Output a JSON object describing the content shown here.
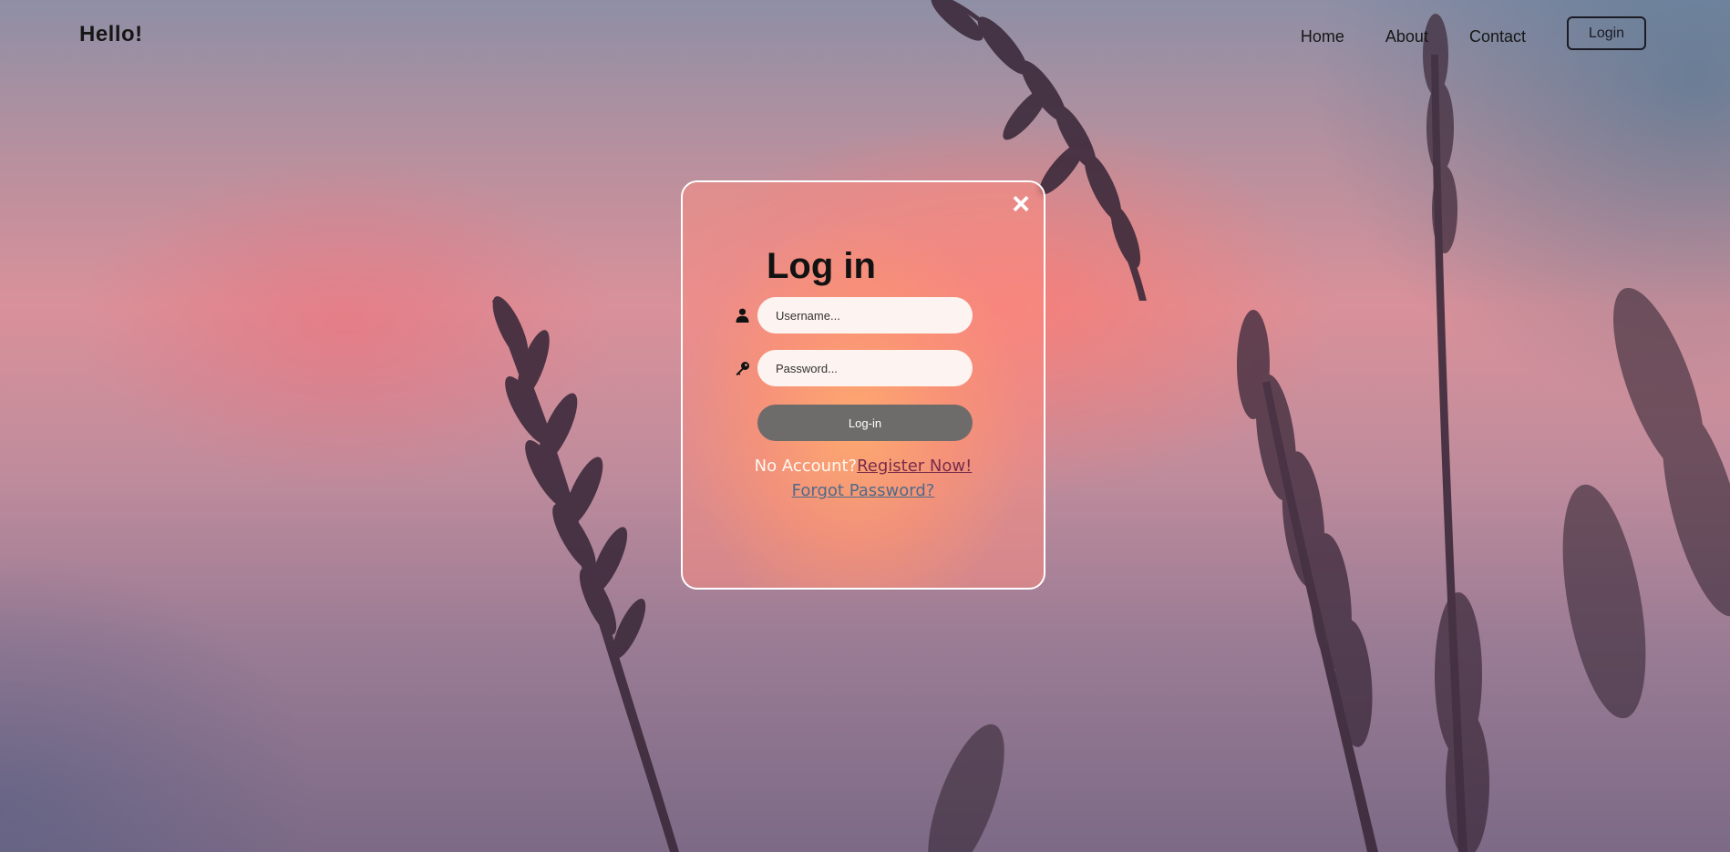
{
  "header": {
    "brand": "Hello!",
    "nav": [
      "Home",
      "About",
      "Contact"
    ],
    "login_button": "Login"
  },
  "modal": {
    "close_icon": "×",
    "title": "Log in",
    "username": {
      "icon": "user-icon",
      "placeholder": "Username..."
    },
    "password": {
      "icon": "key-icon",
      "placeholder": "Password..."
    },
    "submit_label": "Log-in",
    "no_account_text": "No Account?",
    "register_link": "Register Now!",
    "forgot_link": "Forgot Password?"
  },
  "colors": {
    "submit_bg": "#6e6b6b",
    "register_link": "#7a2c4a",
    "forgot_link": "#4f6a8a"
  }
}
